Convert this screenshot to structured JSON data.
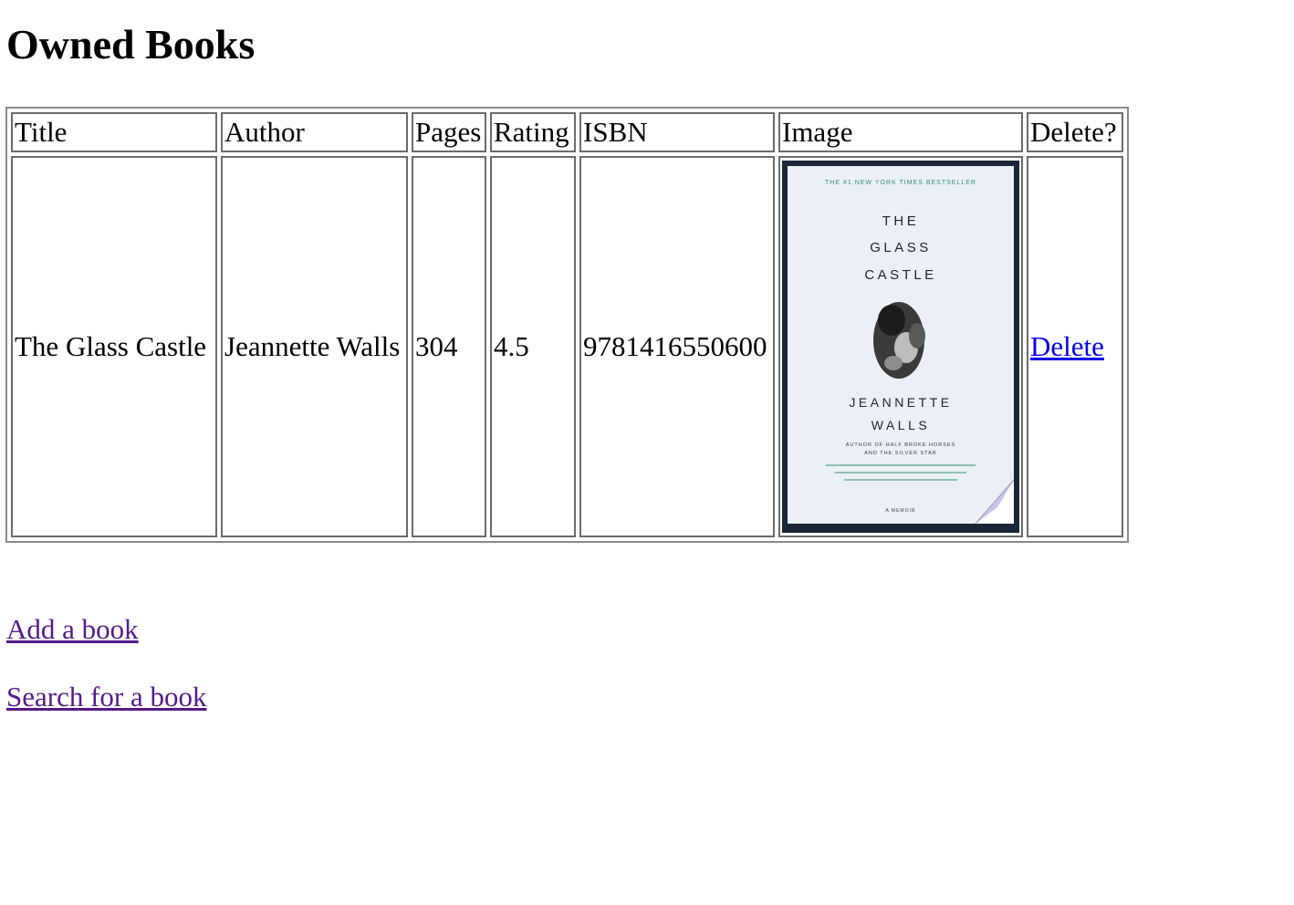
{
  "page": {
    "heading": "Owned Books"
  },
  "table": {
    "headers": {
      "title": "Title",
      "author": "Author",
      "pages": "Pages",
      "rating": "Rating",
      "isbn": "ISBN",
      "image": "Image",
      "delete": "Delete?"
    },
    "rows": [
      {
        "title": "The Glass Castle",
        "author": "Jeannette Walls",
        "pages": "304",
        "rating": "4.5",
        "isbn": "9781416550600",
        "delete_label": "Delete",
        "cover": {
          "banner": "THE #1 NEW YORK TIMES BESTSELLER",
          "title_line1": "THE",
          "title_line2": "GLASS",
          "title_line3": "CASTLE",
          "author_line1": "JEANNETTE",
          "author_line2": "WALLS",
          "credit_line1": "AUTHOR OF HALF BROKE HORSES",
          "credit_line2": "AND THE SILVER STAR",
          "footer": "A MEMOIR",
          "frame_color": "#1b2538",
          "background_color": "#eaf0f6"
        }
      }
    ]
  },
  "links": {
    "add_book": "Add a book",
    "search_book": "Search for a book"
  }
}
